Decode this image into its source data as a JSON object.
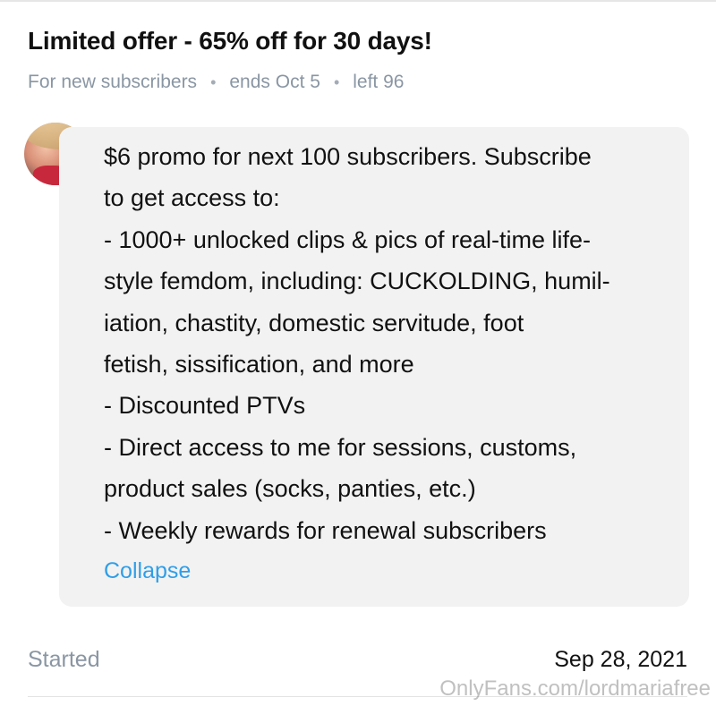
{
  "offer": {
    "title": "Limited offer - 65% off for 30 days!",
    "audience": "For new subscribers",
    "separator": "•",
    "ends": "ends Oct 5",
    "left": "left 96"
  },
  "message": {
    "lines": [
      "$6 promo for next 100 subscribers. Subscribe",
      "to get access to:",
      "- 1000+ unlocked clips & pics of real-time life-",
      "style femdom, including: CUCKOLDING, humil-",
      "iation, chastity, domestic servitude, foot",
      "fetish, sissification, and more",
      "- Discounted PTVs",
      "- Direct access to me for sessions, customs,",
      "product sales (socks, panties, etc.)",
      "- Weekly rewards for renewal subscribers"
    ],
    "collapse_label": "Collapse"
  },
  "footer": {
    "started_label": "Started",
    "started_date": "Sep 28, 2021"
  },
  "watermark": "OnlyFans.com/lordmariafree",
  "colors": {
    "accent": "#2f9ee8",
    "muted": "#8a96a3",
    "bubble": "#f2f2f2"
  }
}
